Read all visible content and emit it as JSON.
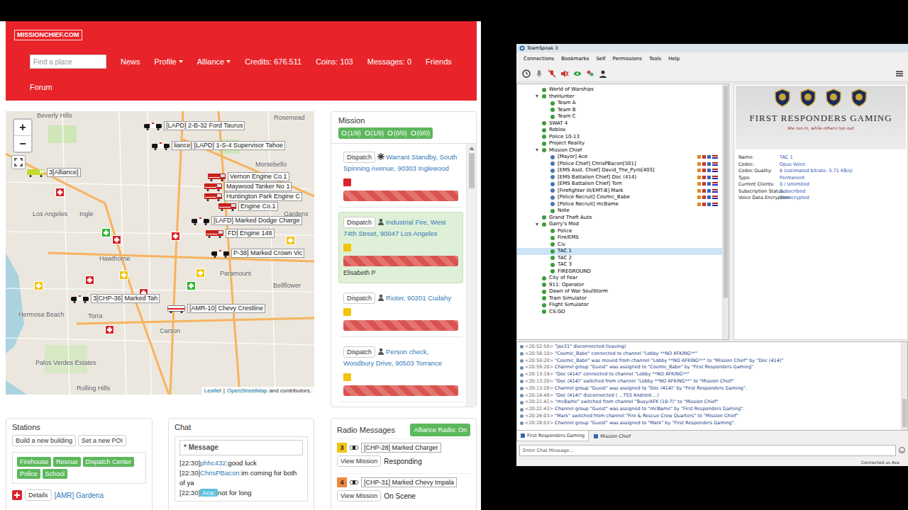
{
  "missionchief": {
    "logo": "MISSIONCHIEF.COM",
    "search": {
      "placeholder": "Find a place"
    },
    "nav": [
      {
        "label": "News",
        "dropdown": false
      },
      {
        "label": "Profile",
        "dropdown": true
      },
      {
        "label": "Alliance",
        "dropdown": true
      },
      {
        "label": "Credits: 676.511",
        "dropdown": false
      },
      {
        "label": "Coins: 103",
        "dropdown": false
      },
      {
        "label": "Messages: 0",
        "dropdown": false
      },
      {
        "label": "Friends",
        "dropdown": false
      },
      {
        "label": "Forum",
        "dropdown": false
      }
    ],
    "map": {
      "zoom_in": "+",
      "zoom_out": "−",
      "places": [
        "Beverly Hills",
        "Rosemead",
        "Montebello",
        "Los Angeles",
        "Ingle",
        "Gardens",
        "Hawthorne",
        "Paramount",
        "Bellflower",
        "Hermosa Beach",
        "Torra",
        "Carson",
        "Palos Verdes Estates",
        "Rolling Hills"
      ],
      "vehicles": [
        {
          "label": "[LAPD] 2-B-32 Ford Taurus",
          "kind": "police"
        },
        {
          "label": "liance] [LAPD] 1-S-4 Supervisor Tahoe",
          "kind": "police"
        },
        {
          "label": "Vernon Engine Co.1",
          "kind": "fire"
        },
        {
          "label": "Maywood Tanker No 1",
          "kind": "fire"
        },
        {
          "label": "Huntington Park Engine C",
          "kind": "fire"
        },
        {
          "label": "Engine Co.1",
          "kind": "fire"
        },
        {
          "label": "[LAFD] Marked Dodge Charge",
          "kind": "police"
        },
        {
          "label": "FD] Engine 148",
          "kind": "fire"
        },
        {
          "label": "P-38] Marked Crown Vic",
          "kind": "police"
        },
        {
          "label": "3[CHP-36] Marked Tah",
          "kind": "police"
        },
        {
          "label": "[AMR-10] Chevy Crestline",
          "kind": "ambulance"
        },
        {
          "label": "3[Alliance]",
          "kind": "rescue"
        }
      ],
      "buildings": [
        {
          "color": "#d9232d"
        },
        {
          "color": "#d9232d"
        },
        {
          "color": "#f2c40f"
        },
        {
          "color": "#d9232d"
        },
        {
          "color": "#2eb82e"
        },
        {
          "color": "#f2c40f"
        },
        {
          "color": "#d9232d"
        },
        {
          "color": "#f2c40f"
        },
        {
          "color": "#2eb82e"
        },
        {
          "color": "#d9232d"
        },
        {
          "color": "#f2c40f"
        },
        {
          "color": "#d9232d"
        }
      ],
      "attribution": [
        {
          "text": "Leaflet",
          "link": true
        },
        {
          "text": "|",
          "link": false
        },
        {
          "text": "OpenStreetMap",
          "link": true
        },
        {
          "text": "and contributors.",
          "link": false
        }
      ]
    },
    "mission_panel": {
      "title": "Mission",
      "counts": [
        "(1/9)",
        "(1/9)",
        "(0/0)",
        "(0/0)"
      ],
      "missions": [
        {
          "button": "Dispatch",
          "kind": "standby",
          "title": "Warrant Standby,",
          "address": "South Spinning Avenue, 90303 Inglewood",
          "color": "#d9232d",
          "level": 1,
          "selected": false
        },
        {
          "button": "Dispatch",
          "kind": "person",
          "title": "Industrial Fire,",
          "address": "West 74th Street, 90047 Los Angeles",
          "color": "#f2c40f",
          "level": 1,
          "selected": true,
          "note": "Elisabeth P"
        },
        {
          "button": "Dispatch",
          "kind": "person",
          "title": "Rioter,",
          "address": "90201 Cudahy",
          "color": "#f2c40f",
          "level": 1,
          "selected": false
        },
        {
          "button": "Dispatch",
          "kind": "person",
          "title": "Person check,",
          "address": "Woodbury Drive, 90503 Torrance",
          "color": "#f2c40f",
          "level": 1,
          "selected": false
        }
      ]
    },
    "stations": {
      "title": "Stations",
      "buttons": [
        "Build a new building",
        "Set a new POI"
      ],
      "filters": [
        "Firehouse",
        "Rescue",
        "Dispatch Center",
        "Police",
        "School"
      ],
      "items": [
        {
          "button": "Details",
          "name": "[AMR] Gardena"
        }
      ]
    },
    "chat": {
      "title": "Chat",
      "placeholder": "* Message",
      "messages": [
        {
          "time": "[22:30]",
          "user": "phhc432:",
          "text": "good luck",
          "highlight": false
        },
        {
          "time": "[22:30]",
          "user": "ChrisPBacon:",
          "text": "im coming for both of ya",
          "highlight": false
        },
        {
          "time": "[22:30]",
          "user": "Ace:",
          "text": "not for long",
          "highlight": true
        }
      ]
    },
    "radio": {
      "title": "Radio Messages",
      "toggle": {
        "label": "Alliance Radio: On",
        "on": true
      },
      "entries": [
        {
          "code": "3",
          "color": "#f0c419",
          "vehicle": "[CHP-28] Marked Charger",
          "button": "View Mission",
          "status": "Responding"
        },
        {
          "code": "4",
          "color": "#f0883e",
          "vehicle": "[CHP-31] Marked Chevy Impala",
          "button": "View Mission",
          "status": "On Scene"
        }
      ]
    }
  },
  "teamspeak": {
    "title": "TeamSpeak 3",
    "menu": [
      "Connections",
      "Bookmarks",
      "Self",
      "Permissions",
      "Tools",
      "Help"
    ],
    "tree": [
      {
        "name": "World of Warships",
        "kind": "channel",
        "expanded": false,
        "selected": false
      },
      {
        "name": "theHunter",
        "kind": "channel",
        "expanded": true,
        "selected": false,
        "children": [
          {
            "name": "Team A",
            "kind": "channel",
            "expanded": false,
            "selected": false
          },
          {
            "name": "Team B",
            "kind": "channel",
            "expanded": false,
            "selected": false
          },
          {
            "name": "Team C",
            "kind": "channel",
            "expanded": false,
            "selected": false
          }
        ]
      },
      {
        "name": "SWAT 4",
        "kind": "channel",
        "expanded": false,
        "selected": false
      },
      {
        "name": "Roblox",
        "kind": "channel",
        "expanded": false,
        "selected": false
      },
      {
        "name": "Police 10-13",
        "kind": "channel",
        "expanded": false,
        "selected": false
      },
      {
        "name": "Project Reality",
        "kind": "channel",
        "expanded": false,
        "selected": false
      },
      {
        "name": "Mission Chief",
        "kind": "channel",
        "expanded": true,
        "selected": false,
        "children": [
          {
            "name": "[Mayor] Ace",
            "kind": "user",
            "expanded": false,
            "selected": false
          },
          {
            "name": "[Police Chief] ChrisPBacon[501]",
            "kind": "user",
            "expanded": false,
            "selected": false
          },
          {
            "name": "[EMS Asst. Chief] David_The_Pyro[403]",
            "kind": "user",
            "expanded": false,
            "selected": false
          },
          {
            "name": "[EMS Battalion Chief] Doc (414)",
            "kind": "user",
            "expanded": false,
            "selected": false
          },
          {
            "name": "[EMS Battalion Chief] Tom",
            "kind": "user",
            "expanded": false,
            "selected": false
          },
          {
            "name": "[Firefighter III/EMT-B] Mark",
            "kind": "user",
            "expanded": false,
            "selected": false
          },
          {
            "name": "[Police Recruit] Cosmic_Babe",
            "kind": "user",
            "expanded": false,
            "selected": false
          },
          {
            "name": "[Police Recruit] mcBame",
            "kind": "user",
            "expanded": false,
            "selected": false
          },
          {
            "name": "Note",
            "kind": "channel",
            "expanded": false,
            "selected": false
          }
        ]
      },
      {
        "name": "Grand Theft Auto",
        "kind": "channel",
        "expanded": false,
        "selected": false
      },
      {
        "name": "Garry's Mod",
        "kind": "channel",
        "expanded": true,
        "selected": false,
        "children": [
          {
            "name": "Police",
            "kind": "channel",
            "expanded": false,
            "selected": false
          },
          {
            "name": "Fire/EMS",
            "kind": "channel",
            "expanded": false,
            "selected": false
          },
          {
            "name": "Civ",
            "kind": "channel",
            "expanded": false,
            "selected": false
          },
          {
            "name": "TAC 1",
            "kind": "channel",
            "expanded": false,
            "selected": true
          },
          {
            "name": "TAC 2",
            "kind": "channel",
            "expanded": false,
            "selected": false
          },
          {
            "name": "TAC 3",
            "kind": "channel",
            "expanded": false,
            "selected": false
          },
          {
            "name": "FIREGROUND",
            "kind": "channel",
            "expanded": false,
            "selected": false
          }
        ]
      },
      {
        "name": "City of Fear",
        "kind": "channel",
        "expanded": false,
        "selected": false
      },
      {
        "name": "911: Operator",
        "kind": "channel",
        "expanded": false,
        "selected": false
      },
      {
        "name": "Dawn of War SoulStorm",
        "kind": "channel",
        "expanded": false,
        "selected": false
      },
      {
        "name": "Train Simulator",
        "kind": "channel",
        "expanded": false,
        "selected": false
      },
      {
        "name": "Flight Simulator",
        "kind": "channel",
        "expanded": false,
        "selected": false
      },
      {
        "name": "CS:GO",
        "kind": "channel",
        "expanded": false,
        "selected": false
      }
    ],
    "banner": {
      "title": "FIRST RESPONDERS GAMING",
      "tagline": "We run in, while others run out"
    },
    "info": [
      {
        "label": "Name:",
        "value": "TAC 1"
      },
      {
        "label": "Codec:",
        "value": "Opus Voice"
      },
      {
        "label": "Codec Quality:",
        "value": "6 (estimated bitrate: 5.71 KB/s)"
      },
      {
        "label": "Type:",
        "value": "Permanent"
      },
      {
        "label": "Current Clients:",
        "value": "0 / Unlimited"
      },
      {
        "label": "Subscription Status:",
        "value": "Subscribed"
      },
      {
        "label": "Voice Data Encryption:",
        "value": "Unencrypted"
      }
    ],
    "log": [
      {
        "time": "<20:52:50>",
        "text": "\"Jax31\" disconnected (leaving)"
      },
      {
        "time": "<20:58:10>",
        "text": "\"Cosmic_Babe\" connected to channel \"Lobby **NO AFKING**\""
      },
      {
        "time": "<20:59:20>",
        "text": "\"Cosmic_Babe\" was moved from channel \"Lobby **NO AFKING**\" to \"Mission Chief\" by \"Doc (414)\""
      },
      {
        "time": "<20:59:20>",
        "text": "Channel group \"Guest\" was assigned to \"Cosmic_Babe\" by \"First Responders Gaming\"."
      },
      {
        "time": "<20:13:19>",
        "text": "\"Doc (414)\" connected to channel \"Lobby **NO AFKING**\""
      },
      {
        "time": "<20:13:20>",
        "text": "\"Doc (414)\" switched from channel \"Lobby **NO AFKING**\" to \"Mission Chief\""
      },
      {
        "time": "<20:13:20>",
        "text": "Channel group \"Guest\" was assigned to \"Doc (414)\" by \"First Responders Gaming\"."
      },
      {
        "time": "<20:14:48>",
        "text": "\"Doc (414)\" disconnected ( ...TS3 Android....)"
      },
      {
        "time": "<20:21:41>",
        "text": "\"mcBame\" switched from channel \"Busy/AFK (10-7)\" to \"Mission Chief\""
      },
      {
        "time": "<20:22:43>",
        "text": "Channel group \"Guest\" was assigned to \"mcBame\" by \"First Responders Gaming\"."
      },
      {
        "time": "<20:26:03>",
        "text": "\"Mark\" switched from channel \"Fire & Rescue Crew Quarters\" to \"Mission Chief\""
      },
      {
        "time": "<20:28:03>",
        "text": "Channel group \"Guest\" was assigned to \"Mark\" by \"First Responders Gaming\"."
      }
    ],
    "tabs": [
      {
        "label": "First Responders Gaming",
        "selected": true
      },
      {
        "label": "Mission Chief",
        "selected": false
      }
    ],
    "chat_placeholder": "Enter Chat Message...",
    "status": "Connected as Ace"
  }
}
